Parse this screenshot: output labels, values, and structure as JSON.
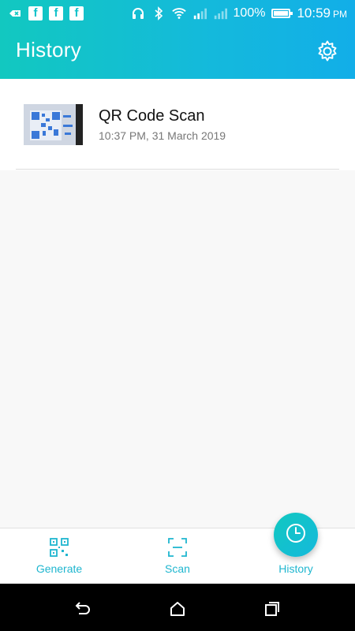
{
  "status_bar": {
    "battery_percent": "100%",
    "time": "10:59",
    "ampm": "PM",
    "left_icons": [
      "usb-icon",
      "facebook-icon",
      "facebook-icon",
      "facebook-icon"
    ],
    "right_icons": [
      "headset-icon",
      "bluetooth-icon",
      "wifi-icon",
      "signal-1-icon",
      "signal-2-icon",
      "battery-icon"
    ],
    "fb_letter": "f"
  },
  "header": {
    "title": "History"
  },
  "history": {
    "items": [
      {
        "title": "QR Code Scan",
        "timestamp": "10:37 PM, 31 March 2019"
      }
    ]
  },
  "bottom_nav": {
    "items": [
      {
        "label": "Generate",
        "icon": "qr-code-icon"
      },
      {
        "label": "Scan",
        "icon": "scan-frame-icon"
      },
      {
        "label": "History",
        "icon": "clock-icon"
      }
    ],
    "selected": "History"
  },
  "colors": {
    "accent": "#1fb6cf",
    "header_start": "#12c8c0",
    "header_end": "#12aee8"
  }
}
